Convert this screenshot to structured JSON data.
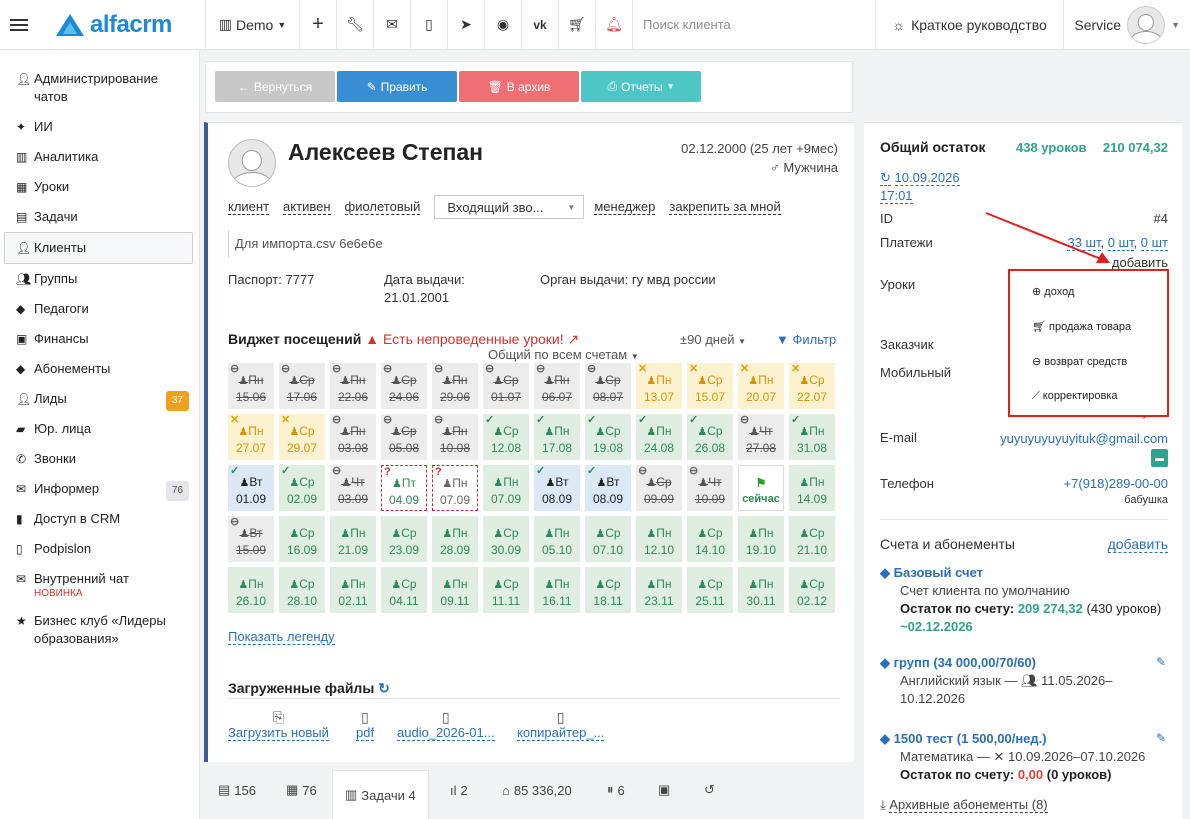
{
  "topbar": {
    "logo": "alfacrm",
    "branch": "Demo",
    "search_placeholder": "Поиск клиента",
    "guide": "Краткое руководство",
    "user": "Service"
  },
  "sidebar": {
    "items": [
      {
        "label": "Администрирование чатов",
        "icon": "user-icon"
      },
      {
        "label": "ИИ",
        "icon": "sparkle-icon"
      },
      {
        "label": "Аналитика",
        "icon": "map-icon"
      },
      {
        "label": "Уроки",
        "icon": "calendar-icon"
      },
      {
        "label": "Задачи",
        "icon": "tasks-icon"
      },
      {
        "label": "Клиенты",
        "icon": "user-icon"
      },
      {
        "label": "Группы",
        "icon": "users-icon"
      },
      {
        "label": "Педагоги",
        "icon": "graduation-cap-icon"
      },
      {
        "label": "Финансы",
        "icon": "money-icon"
      },
      {
        "label": "Абонементы",
        "icon": "tag-icon"
      },
      {
        "label": "Лиды",
        "icon": "user-plus-icon",
        "badge": "37"
      },
      {
        "label": "Юр. лица",
        "icon": "briefcase-icon"
      },
      {
        "label": "Звонки",
        "icon": "phone-icon"
      },
      {
        "label": "Информер",
        "icon": "envelope-icon",
        "badge": "76"
      },
      {
        "label": "Доступ в CRM",
        "icon": "lock-icon"
      },
      {
        "label": "Podpislon",
        "icon": "document-icon"
      },
      {
        "label": "Внутренний чат",
        "icon": "envelope-icon",
        "sub": "НОВИНКА"
      },
      {
        "label": "Бизнес клуб «Лидеры образования»",
        "icon": "star-icon"
      }
    ]
  },
  "actions": {
    "back": "Вернуться",
    "edit": "Править",
    "archive": "В архив",
    "reports": "Отчеты"
  },
  "client": {
    "name": "Алексеев Степан",
    "dob": "02.12.2000 (25 лет +9мес)",
    "gender": "Мужчина",
    "tags": [
      "клиент",
      "активен",
      "фиолетовый"
    ],
    "call_status": "Входящий зво...",
    "manager": "менеджер",
    "pin": "закрепить за мной",
    "note": "Для импорта.csv 6e6e6e",
    "passport_label": "Паспорт:",
    "passport": "7777",
    "issued_label": "Дата выдачи:",
    "issued": "21.01.2001",
    "authority_label": "Орган выдачи:",
    "authority": "гу мвд россии"
  },
  "widget": {
    "title": "Виджет посещений",
    "warning": "Есть непроведенные уроки!",
    "range": "±90 дней",
    "filter": "Фильтр",
    "scope": "Общий по всем счетам",
    "legend_link": "Показать легенду",
    "cells": [
      [
        "x",
        "Пн",
        "15.06",
        "minus"
      ],
      [
        "x",
        "Ср",
        "17.06",
        "minus"
      ],
      [
        "x",
        "Пн",
        "22.06",
        "minus"
      ],
      [
        "x",
        "Ср",
        "24.06",
        "minus"
      ],
      [
        "x",
        "Пн",
        "29.06",
        "minus"
      ],
      [
        "x",
        "Ср",
        "01.07",
        "minus"
      ],
      [
        "x",
        "Пн",
        "06.07",
        "minus"
      ],
      [
        "x",
        "Ср",
        "08.07",
        "minus"
      ],
      [
        "y",
        "Пн",
        "13.07",
        "cross"
      ],
      [
        "y",
        "Ср",
        "15.07",
        "cross"
      ],
      [
        "y",
        "Пн",
        "20.07",
        "cross"
      ],
      [
        "y",
        "Ср",
        "22.07",
        "cross"
      ],
      [
        "y",
        "Пн",
        "27.07",
        "cross"
      ],
      [
        "y",
        "Ср",
        "29.07",
        "cross"
      ],
      [
        "x",
        "Пн",
        "03.08",
        "minus"
      ],
      [
        "x",
        "Ср",
        "05.08",
        "minus"
      ],
      [
        "x",
        "Пн",
        "10.08",
        "minus"
      ],
      [
        "g",
        "Ср",
        "12.08",
        "check"
      ],
      [
        "g",
        "Пн",
        "17.08",
        "check"
      ],
      [
        "g",
        "Ср",
        "19.08",
        "check"
      ],
      [
        "g",
        "Пн",
        "24.08",
        "check"
      ],
      [
        "g",
        "Ср",
        "26.08",
        "check"
      ],
      [
        "x",
        "Чт",
        "27.08",
        "minus"
      ],
      [
        "g",
        "Пн",
        "31.08",
        "check"
      ],
      [
        "b",
        "Вт",
        "01.09",
        "check"
      ],
      [
        "g",
        "Ср",
        "02.09",
        "check"
      ],
      [
        "x",
        "Чт",
        "03.09",
        "minus"
      ],
      [
        "d",
        "Пт",
        "04.09",
        "?"
      ],
      [
        "d2",
        "Пн",
        "07.09",
        "?"
      ],
      [
        "g",
        "Пн",
        "07.09",
        ""
      ],
      [
        "b",
        "Вт",
        "08.09",
        "check"
      ],
      [
        "b",
        "Вт",
        "08.09",
        "check"
      ],
      [
        "x",
        "Ср",
        "09.09",
        "minus"
      ],
      [
        "x",
        "Чт",
        "10.09",
        "minus"
      ],
      [
        "w",
        "⚑",
        "сейчас",
        ""
      ],
      [
        "g",
        "Пн",
        "14.09",
        ""
      ],
      [
        "x",
        "Вт",
        "15.09",
        "minus"
      ],
      [
        "g",
        "Ср",
        "16.09",
        ""
      ],
      [
        "g",
        "Пн",
        "21.09",
        ""
      ],
      [
        "g",
        "Ср",
        "23.09",
        ""
      ],
      [
        "g",
        "Пн",
        "28.09",
        ""
      ],
      [
        "g",
        "Ср",
        "30.09",
        ""
      ],
      [
        "g",
        "Пн",
        "05.10",
        ""
      ],
      [
        "g",
        "Ср",
        "07.10",
        ""
      ],
      [
        "g",
        "Пн",
        "12.10",
        ""
      ],
      [
        "g",
        "Ср",
        "14.10",
        ""
      ],
      [
        "g",
        "Пн",
        "19.10",
        ""
      ],
      [
        "g",
        "Ср",
        "21.10",
        ""
      ],
      [
        "g",
        "Пн",
        "26.10",
        ""
      ],
      [
        "g",
        "Ср",
        "28.10",
        ""
      ],
      [
        "g",
        "Пн",
        "02.11",
        ""
      ],
      [
        "g",
        "Ср",
        "04.11",
        ""
      ],
      [
        "g",
        "Пн",
        "09.11",
        ""
      ],
      [
        "g",
        "Ср",
        "11.11",
        ""
      ],
      [
        "g",
        "Пн",
        "16.11",
        ""
      ],
      [
        "g",
        "Ср",
        "18.11",
        ""
      ],
      [
        "g",
        "Пн",
        "23.11",
        ""
      ],
      [
        "g",
        "Ср",
        "25.11",
        ""
      ],
      [
        "g",
        "Пн",
        "30.11",
        ""
      ],
      [
        "g",
        "Ср",
        "02.12",
        ""
      ]
    ]
  },
  "files": {
    "title": "Загруженные файлы",
    "items": [
      "Загрузить новый",
      "pdf",
      "audio_2026-01...",
      "копирайтер_..."
    ]
  },
  "tabs": [
    "156",
    "76",
    "Задачи 4",
    "2",
    "85 336,20",
    "6",
    "",
    ""
  ],
  "right": {
    "title": "Общий остаток",
    "lessons": "438 уроков",
    "amount": "210 074,32",
    "date": "10.09.2026",
    "time": "17:01",
    "id_label": "ID",
    "id": "#4",
    "payments_label": "Платежи",
    "payments": [
      "33 шт",
      "0 шт",
      "0 шт"
    ],
    "add": "добавить",
    "lessons_label": "Уроки",
    "customer_label": "Заказчик",
    "mobile_label": "Мобильный",
    "mobile_tail": "бабушка",
    "email_label": "E-mail",
    "email": "yuyuyuyuyuyituk@gmail.com",
    "phone_label": "Телефон",
    "phone": "+7(918)289-00-00",
    "phone_note": "бабушка",
    "accounts_title": "Счета и абонементы",
    "accounts_add": "добавить",
    "base_account": "Базовый счет",
    "base_default": "Счет клиента по умолчанию",
    "base_balance_label": "Остаток по счету:",
    "base_balance": "209 274,32",
    "base_balance_lessons": "(430 уроков)",
    "base_balance_date": "~02.12.2026",
    "group_sub": "групп (34 000,00/70/60)",
    "group_info": "Английский язык —",
    "group_dates": "11.05.2026–10.12.2026",
    "test_sub": "1500 тест (1 500,00/нед.)",
    "test_info": "Математика —",
    "test_dates": "10.09.2026–07.10.2026",
    "test_balance_label": "Остаток по счету:",
    "test_balance": "0,00",
    "test_balance_lessons": "(0 уроков)",
    "archive": "Архивные абонементы (8)"
  },
  "dropdown": {
    "items": [
      "доход",
      "продажа товара",
      "возврат средств",
      "корректировка"
    ]
  },
  "colors": {
    "brand": "#1c8ad6",
    "back": "#c8c8c8",
    "edit": "#3a8fd4",
    "archive": "#ef6f75",
    "reports": "#4fc6c6",
    "annotation": "#e02020"
  }
}
